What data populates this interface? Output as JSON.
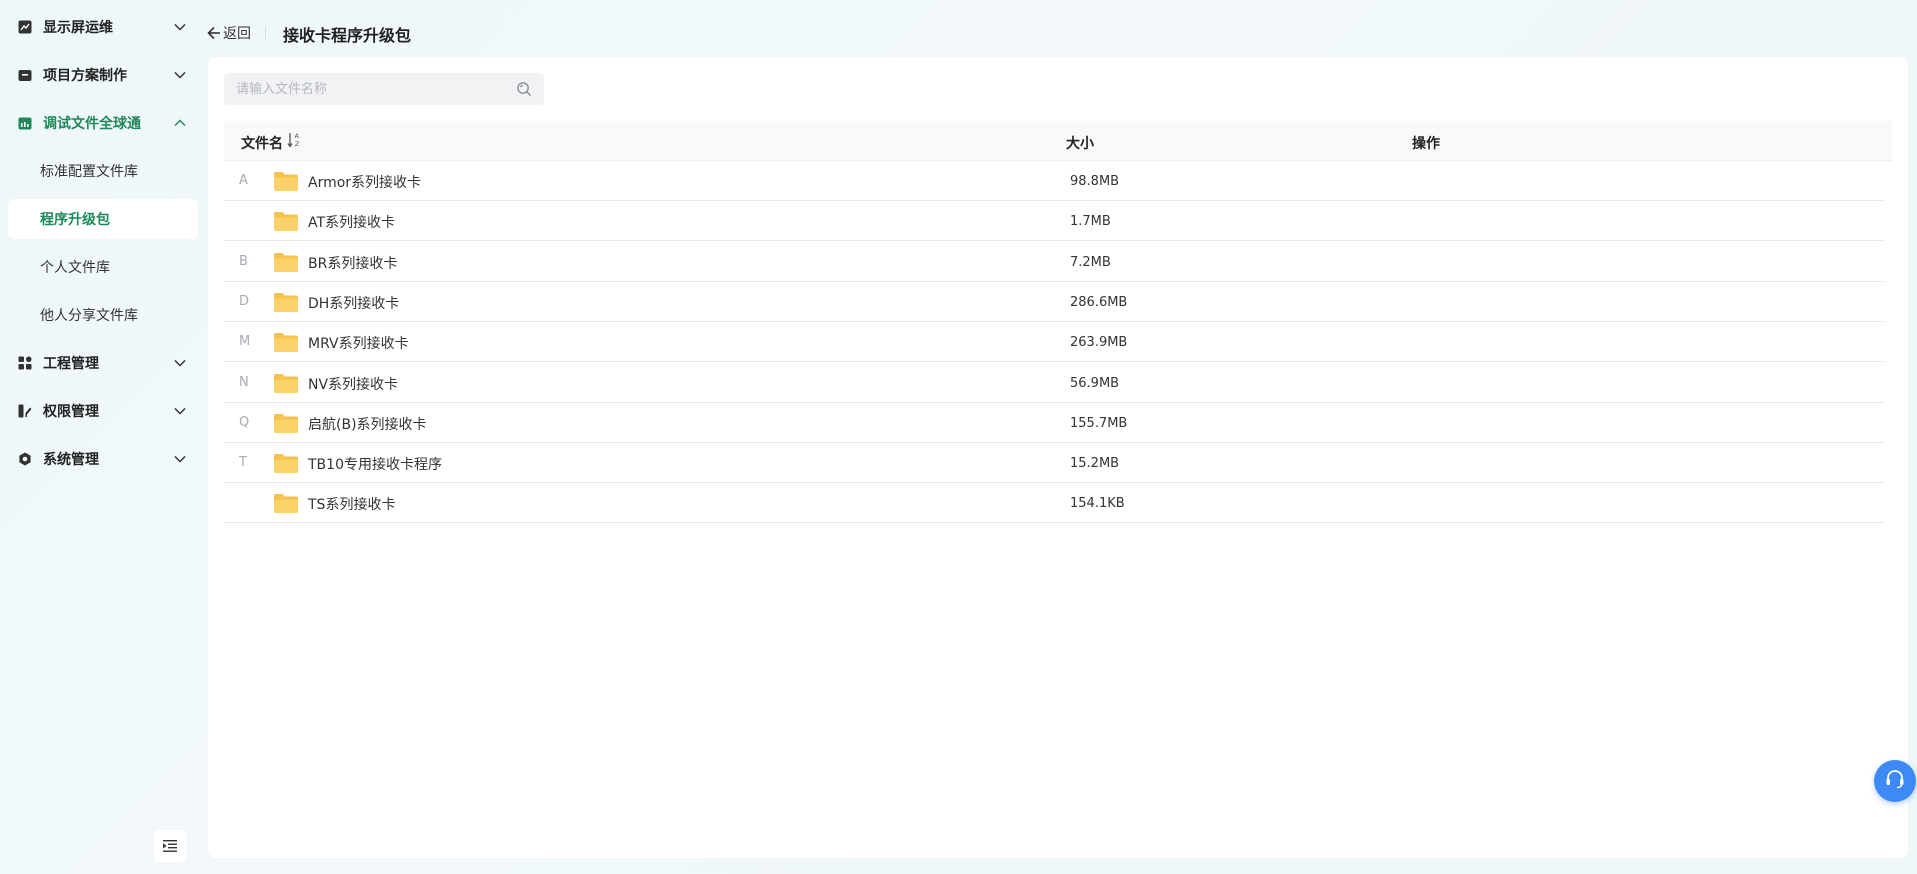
{
  "sidebar": {
    "groups": [
      {
        "label": "显示屏运维",
        "icon": "chart-icon"
      },
      {
        "label": "项目方案制作",
        "icon": "briefcase-icon"
      },
      {
        "label": "调试文件全球通",
        "icon": "calendar-icon",
        "expanded": true
      },
      {
        "label": "工程管理",
        "icon": "grid-icon"
      },
      {
        "label": "权限管理",
        "icon": "key-icon"
      },
      {
        "label": "系统管理",
        "icon": "settings-icon"
      }
    ],
    "subitems": [
      {
        "label": "标准配置文件库"
      },
      {
        "label": "程序升级包",
        "active": true
      },
      {
        "label": "个人文件库"
      },
      {
        "label": "他人分享文件库"
      }
    ]
  },
  "header": {
    "back_label": "返回",
    "title": "接收卡程序升级包"
  },
  "search": {
    "placeholder": "请输入文件名称"
  },
  "table": {
    "columns": [
      "文件名",
      "大小",
      "操作"
    ],
    "rows": [
      {
        "letter": "A",
        "name": "Armor系列接收卡",
        "size": "98.8MB"
      },
      {
        "letter": "",
        "name": "AT系列接收卡",
        "size": "1.7MB"
      },
      {
        "letter": "B",
        "name": "BR系列接收卡",
        "size": "7.2MB"
      },
      {
        "letter": "D",
        "name": "DH系列接收卡",
        "size": "286.6MB"
      },
      {
        "letter": "M",
        "name": "MRV系列接收卡",
        "size": "263.9MB"
      },
      {
        "letter": "N",
        "name": "NV系列接收卡",
        "size": "56.9MB"
      },
      {
        "letter": "Q",
        "name": "启航(B)系列接收卡",
        "size": "155.7MB"
      },
      {
        "letter": "T",
        "name": "TB10专用接收卡程序",
        "size": "15.2MB"
      },
      {
        "letter": "",
        "name": "TS系列接收卡",
        "size": "154.1KB"
      }
    ]
  },
  "colors": {
    "accent": "#1e8a5a",
    "folder": "#f7c74f",
    "service": "#3d8af7"
  }
}
